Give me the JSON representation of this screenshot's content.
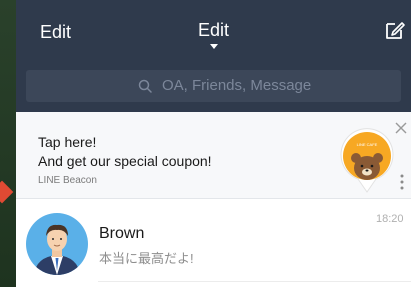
{
  "header": {
    "left_label": "Edit",
    "center_label": "Edit"
  },
  "search": {
    "placeholder": "OA, Friends, Message"
  },
  "beacon": {
    "line1": "Tap here!",
    "line2": "And get our special coupon!",
    "source": "LINE Beacon",
    "logo_text": "LINE CAFE"
  },
  "chats": [
    {
      "name": "Brown",
      "message": "本当に最高だよ!",
      "time": "18:20"
    }
  ],
  "colors": {
    "header_bg": "#2f3a4c",
    "search_bg": "#3c4759",
    "beacon_bg": "#f7f8fa",
    "badge_orange": "#f7a823",
    "bear_brown": "#8a5a35",
    "avatar_blue": "#5ab0e8"
  }
}
